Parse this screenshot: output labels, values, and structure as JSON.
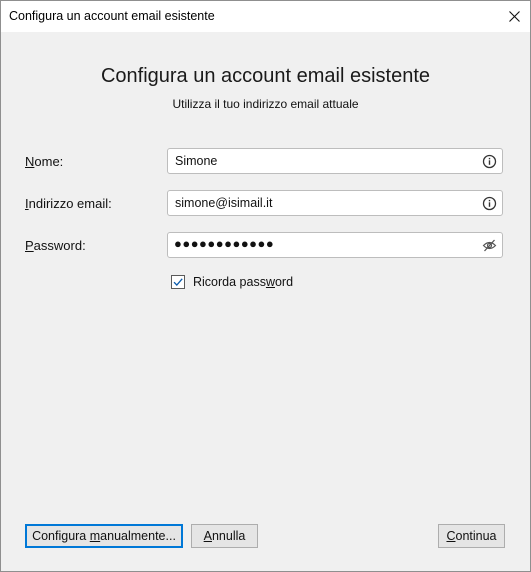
{
  "window": {
    "title": "Configura un account email esistente"
  },
  "header": {
    "heading": "Configura un account email esistente",
    "subheading": "Utilizza il tuo indirizzo email attuale"
  },
  "form": {
    "name": {
      "label_accel": "N",
      "label_rest": "ome:",
      "value": "Simone",
      "icon": "info-icon"
    },
    "email": {
      "label_accel": "I",
      "label_rest": "ndirizzo email:",
      "value": "simone@isimail.it",
      "icon": "info-icon"
    },
    "password": {
      "label_accel": "P",
      "label_rest": "assword:",
      "value": "●●●●●●●●●●●●",
      "icon": "eye-slash-icon"
    },
    "remember": {
      "label_pre": "Ricorda pass",
      "label_accel": "w",
      "label_post": "ord",
      "checked": true
    }
  },
  "buttons": {
    "manual": {
      "pre": "Configura ",
      "accel": "m",
      "post": "anualmente..."
    },
    "cancel": {
      "pre": "",
      "accel": "A",
      "post": "nnulla"
    },
    "continue": {
      "pre": "",
      "accel": "C",
      "post": "ontinua"
    }
  },
  "colors": {
    "focus_border": "#0078d7",
    "window_bg": "#f0f0f0"
  }
}
